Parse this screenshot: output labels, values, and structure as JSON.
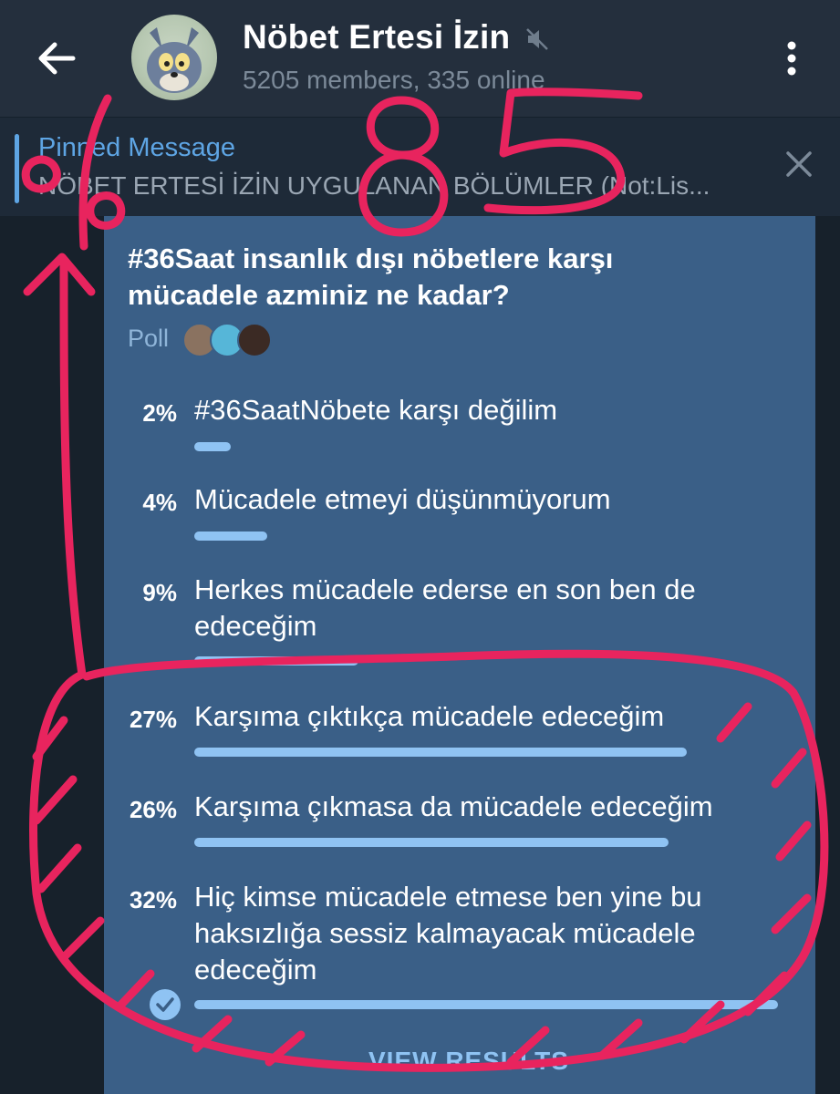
{
  "header": {
    "title": "Nöbet Ertesi İzin",
    "subtitle": "5205 members, 335 online"
  },
  "pinned": {
    "label": "Pinned Message",
    "text": "NÖBET ERTESİ İZİN UYGULANAN BÖLÜMLER (Not:Lis..."
  },
  "poll": {
    "question": "#36Saat insanlık dışı nöbetlere karşı mücadele azminiz ne kadar?",
    "type_label": "Poll",
    "options": [
      {
        "percent_label": "2%",
        "percent": 2,
        "text": "#36SaatNöbete karşı değilim"
      },
      {
        "percent_label": "4%",
        "percent": 4,
        "text": "Mücadele etmeyi düşünmüyorum"
      },
      {
        "percent_label": "9%",
        "percent": 9,
        "text": "Herkes mücadele ederse en son ben de edeceğim"
      },
      {
        "percent_label": "27%",
        "percent": 27,
        "text": "Karşıma çıktıkça mücadele edeceğim"
      },
      {
        "percent_label": "26%",
        "percent": 26,
        "text": "Karşıma çıkmasa da mücadele edeceğim"
      },
      {
        "percent_label": "32%",
        "percent": 32,
        "text": "Hiç kimse mücadele etmese ben yine bu haksızlığa sessiz kalmayacak mücadele edeceğim",
        "selected": true
      }
    ],
    "view_results": "VIEW RESULTS"
  },
  "annotation": {
    "text": "%85",
    "color": "#e8245e"
  },
  "colors": {
    "accent": "#5ea5e4",
    "bar": "#8fc3f3",
    "bubble": "#3a5f87",
    "header": "#242f3d"
  },
  "icons": [
    "back-arrow-icon",
    "mute-icon",
    "menu-dots-icon",
    "close-icon",
    "check-icon"
  ]
}
